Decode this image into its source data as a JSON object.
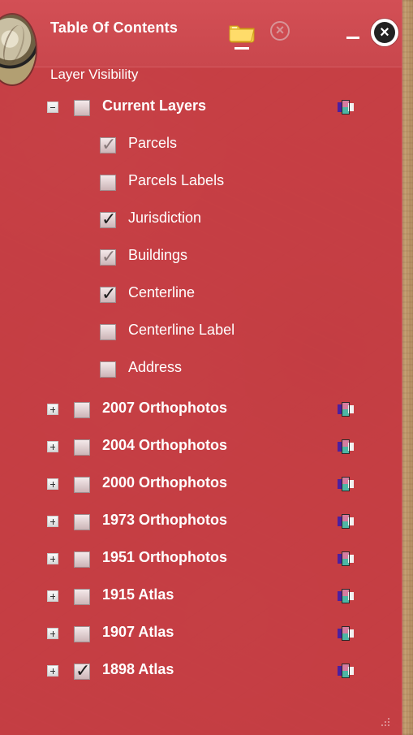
{
  "panel": {
    "title": "Table Of Contents",
    "subtitle": "Layer Visibility",
    "icons": {
      "open_folder": "folder-icon",
      "clear": "disabled-close-icon",
      "minimize": "minimize-icon",
      "close": "close-icon",
      "legend": "legend-icon"
    },
    "colors": {
      "panel_red": "#c53e43",
      "header_red": "#d34f55",
      "text": "#ffffff",
      "folder_yellow": "#f2c94c"
    }
  },
  "layers": [
    {
      "label": "Current Layers",
      "level": "parent",
      "expanded": true,
      "checked": false,
      "legend": true
    },
    {
      "label": "Parcels",
      "level": "child",
      "checked": "partial"
    },
    {
      "label": "Parcels Labels",
      "level": "child",
      "checked": false
    },
    {
      "label": "Jurisdiction",
      "level": "child",
      "checked": true
    },
    {
      "label": "Buildings",
      "level": "child",
      "checked": "partial"
    },
    {
      "label": "Centerline",
      "level": "child",
      "checked": true
    },
    {
      "label": "Centerline Label",
      "level": "child",
      "checked": false
    },
    {
      "label": "Address",
      "level": "child",
      "checked": false
    },
    {
      "label": "2007 Orthophotos",
      "level": "parent",
      "expanded": false,
      "checked": false,
      "legend": true
    },
    {
      "label": "2004 Orthophotos",
      "level": "parent",
      "expanded": false,
      "checked": false,
      "legend": true
    },
    {
      "label": "2000 Orthophotos",
      "level": "parent",
      "expanded": false,
      "checked": false,
      "legend": true
    },
    {
      "label": "1973 Orthophotos",
      "level": "parent",
      "expanded": false,
      "checked": false,
      "legend": true
    },
    {
      "label": "1951 Orthophotos",
      "level": "parent",
      "expanded": false,
      "checked": false,
      "legend": true
    },
    {
      "label": "1915 Atlas",
      "level": "parent",
      "expanded": false,
      "checked": false,
      "legend": true
    },
    {
      "label": "1907 Atlas",
      "level": "parent",
      "expanded": false,
      "checked": false,
      "legend": true
    },
    {
      "label": "1898 Atlas",
      "level": "parent",
      "expanded": false,
      "checked": true,
      "legend": true
    }
  ]
}
